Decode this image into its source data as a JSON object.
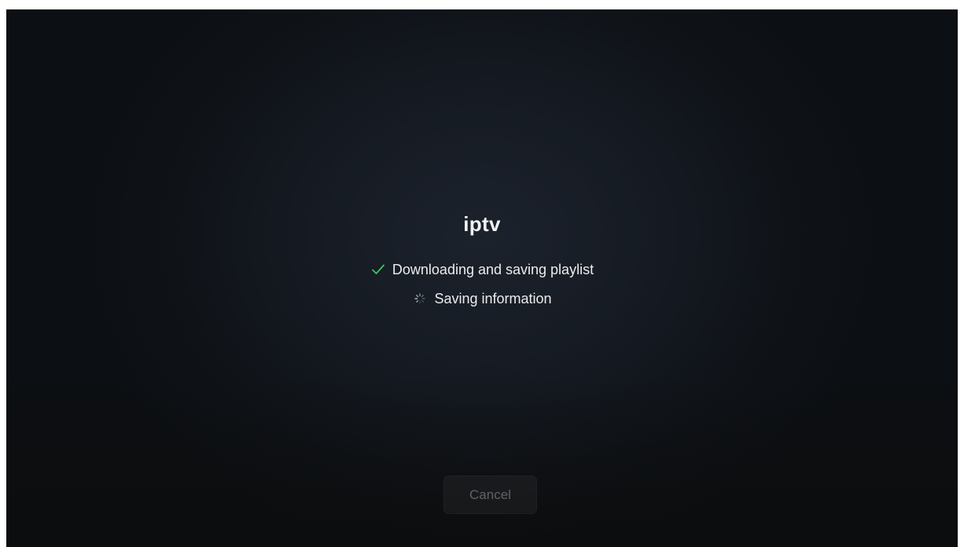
{
  "app": {
    "title": "iptv"
  },
  "steps": [
    {
      "label": "Downloading and saving playlist",
      "status": "done",
      "icon": "check-icon"
    },
    {
      "label": "Saving information",
      "status": "in-progress",
      "icon": "spinner-icon"
    }
  ],
  "actions": {
    "cancel_label": "Cancel"
  },
  "colors": {
    "check": "#3fc45a",
    "text": "#ececec",
    "cancel_text": "#5e6166"
  }
}
